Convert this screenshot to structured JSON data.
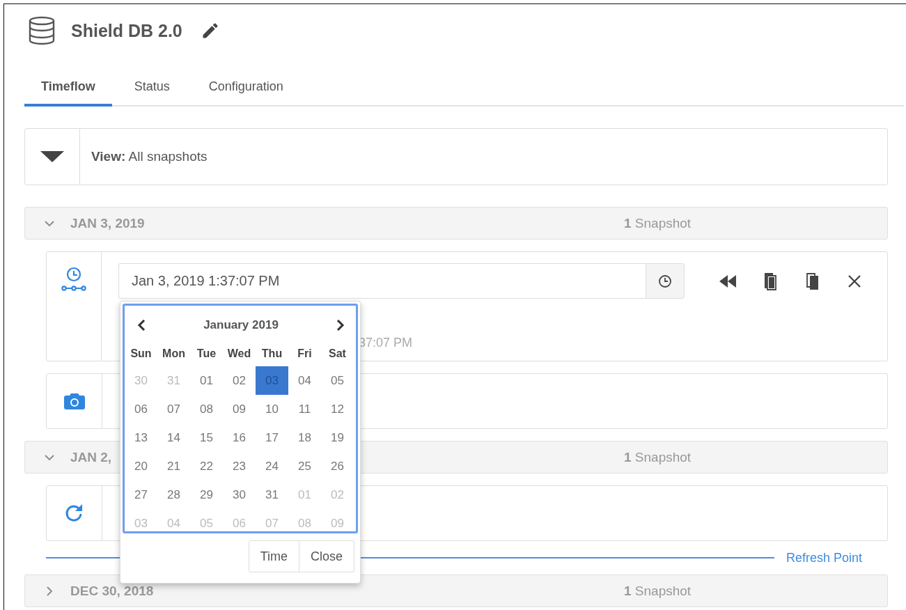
{
  "header": {
    "title": "Shield DB 2.0"
  },
  "tabs": [
    {
      "label": "Timeflow",
      "selected": true
    },
    {
      "label": "Status",
      "selected": false
    },
    {
      "label": "Configuration",
      "selected": false
    }
  ],
  "view": {
    "text": "**View:** All snapshots"
  },
  "groups": [
    {
      "date": "JAN 3, 2019",
      "count": "**1** Snapshot",
      "expanded": true,
      "snapshots": [
        {
          "kind": "timeflow",
          "time_value": "Jan 3, 2019 1:37:07 PM",
          "detail": "37:07 PM"
        },
        {
          "kind": "snapshot"
        }
      ]
    },
    {
      "date": "JAN 2,",
      "count": "**1** Snapshot",
      "expanded": true,
      "snapshots": [
        {
          "kind": "refresh"
        }
      ],
      "marker": "Refresh Point"
    },
    {
      "date": "DEC 30, 2018",
      "count": "**1** Snapshot",
      "expanded": false
    }
  ],
  "date_picker": {
    "month": "January 2019",
    "weekdays": [
      "Sun",
      "Mon",
      "Tue",
      "Wed",
      "Thu",
      "Fri",
      "Sat"
    ],
    "weeks": [
      [
        {
          "day": "30",
          "muted": true,
          "selected": false
        },
        {
          "day": "31",
          "muted": true,
          "selected": false
        },
        {
          "day": "01",
          "muted": false,
          "selected": false
        },
        {
          "day": "02",
          "muted": false,
          "selected": false
        },
        {
          "day": "03",
          "muted": false,
          "selected": true
        },
        {
          "day": "04",
          "muted": false,
          "selected": false
        },
        {
          "day": "05",
          "muted": false,
          "selected": false
        }
      ],
      [
        {
          "day": "06",
          "muted": false,
          "selected": false
        },
        {
          "day": "07",
          "muted": false,
          "selected": false
        },
        {
          "day": "08",
          "muted": false,
          "selected": false
        },
        {
          "day": "09",
          "muted": false,
          "selected": false
        },
        {
          "day": "10",
          "muted": false,
          "selected": false
        },
        {
          "day": "11",
          "muted": false,
          "selected": false
        },
        {
          "day": "12",
          "muted": false,
          "selected": false
        }
      ],
      [
        {
          "day": "13",
          "muted": false,
          "selected": false
        },
        {
          "day": "14",
          "muted": false,
          "selected": false
        },
        {
          "day": "15",
          "muted": false,
          "selected": false
        },
        {
          "day": "16",
          "muted": false,
          "selected": false
        },
        {
          "day": "17",
          "muted": false,
          "selected": false
        },
        {
          "day": "18",
          "muted": false,
          "selected": false
        },
        {
          "day": "19",
          "muted": false,
          "selected": false
        }
      ],
      [
        {
          "day": "20",
          "muted": false,
          "selected": false
        },
        {
          "day": "21",
          "muted": false,
          "selected": false
        },
        {
          "day": "22",
          "muted": false,
          "selected": false
        },
        {
          "day": "23",
          "muted": false,
          "selected": false
        },
        {
          "day": "24",
          "muted": false,
          "selected": false
        },
        {
          "day": "25",
          "muted": false,
          "selected": false
        },
        {
          "day": "26",
          "muted": false,
          "selected": false
        }
      ],
      [
        {
          "day": "27",
          "muted": false,
          "selected": false
        },
        {
          "day": "28",
          "muted": false,
          "selected": false
        },
        {
          "day": "29",
          "muted": false,
          "selected": false
        },
        {
          "day": "30",
          "muted": false,
          "selected": false
        },
        {
          "day": "31",
          "muted": false,
          "selected": false
        },
        {
          "day": "01",
          "muted": true,
          "selected": false
        },
        {
          "day": "02",
          "muted": true,
          "selected": false
        }
      ],
      [
        {
          "day": "03",
          "muted": true,
          "selected": false
        },
        {
          "day": "04",
          "muted": true,
          "selected": false
        },
        {
          "day": "05",
          "muted": true,
          "selected": false
        },
        {
          "day": "06",
          "muted": true,
          "selected": false
        },
        {
          "day": "07",
          "muted": true,
          "selected": false
        },
        {
          "day": "08",
          "muted": true,
          "selected": false
        },
        {
          "day": "09",
          "muted": true,
          "selected": false
        }
      ]
    ],
    "buttons": [
      "Time",
      "Close"
    ]
  }
}
